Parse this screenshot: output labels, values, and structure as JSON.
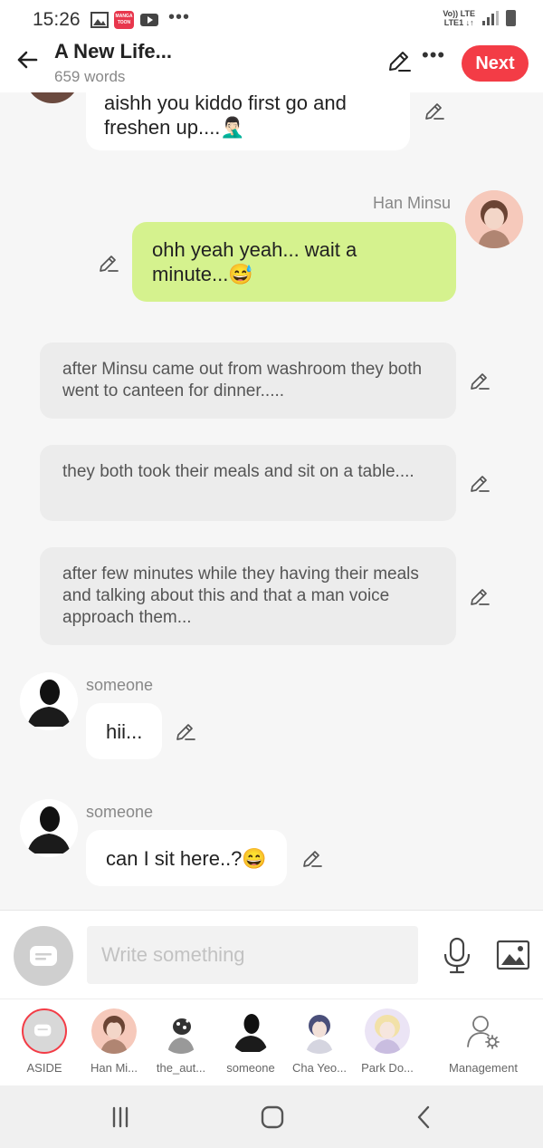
{
  "status_bar": {
    "time": "15:26",
    "network_line1": "Vo)) LTE",
    "network_line2": "LTE1 ↓↑",
    "app_badge": "MANGA TOON",
    "notification_icons": [
      "gallery-icon",
      "mangatoon-icon",
      "youtube-icon",
      "more-dots-icon"
    ]
  },
  "header": {
    "title": "A New Life...",
    "word_count": "659 words",
    "next_label": "Next",
    "accent_color": "#f33c46"
  },
  "messages": {
    "m1": {
      "text": "aishh you kiddo first go and freshen up....🤦🏻‍♂️"
    },
    "m2": {
      "sender": "Han Minsu",
      "text": "ohh yeah yeah... wait a minute...😅"
    },
    "n1": {
      "text": "after Minsu came out from washroom they both went to canteen for dinner....."
    },
    "n2": {
      "text": "they both took their meals and sit on a table...."
    },
    "n3": {
      "text": "after few minutes while they having their meals and talking about this and that a man voice approach them..."
    },
    "m3": {
      "sender": "someone",
      "text": "hii..."
    },
    "m4": {
      "sender": "someone",
      "text": "can I sit here..?😄"
    }
  },
  "composer": {
    "placeholder": "Write something"
  },
  "characters": [
    {
      "label": "ASIDE"
    },
    {
      "label": "Han Mi..."
    },
    {
      "label": "the_aut..."
    },
    {
      "label": "someone"
    },
    {
      "label": "Cha Yeo..."
    },
    {
      "label": "Park Do..."
    },
    {
      "label": "Management"
    }
  ],
  "colors": {
    "green_bubble": "#d5f28e",
    "narration_bg": "#ececec",
    "background": "#f6f6f6"
  }
}
